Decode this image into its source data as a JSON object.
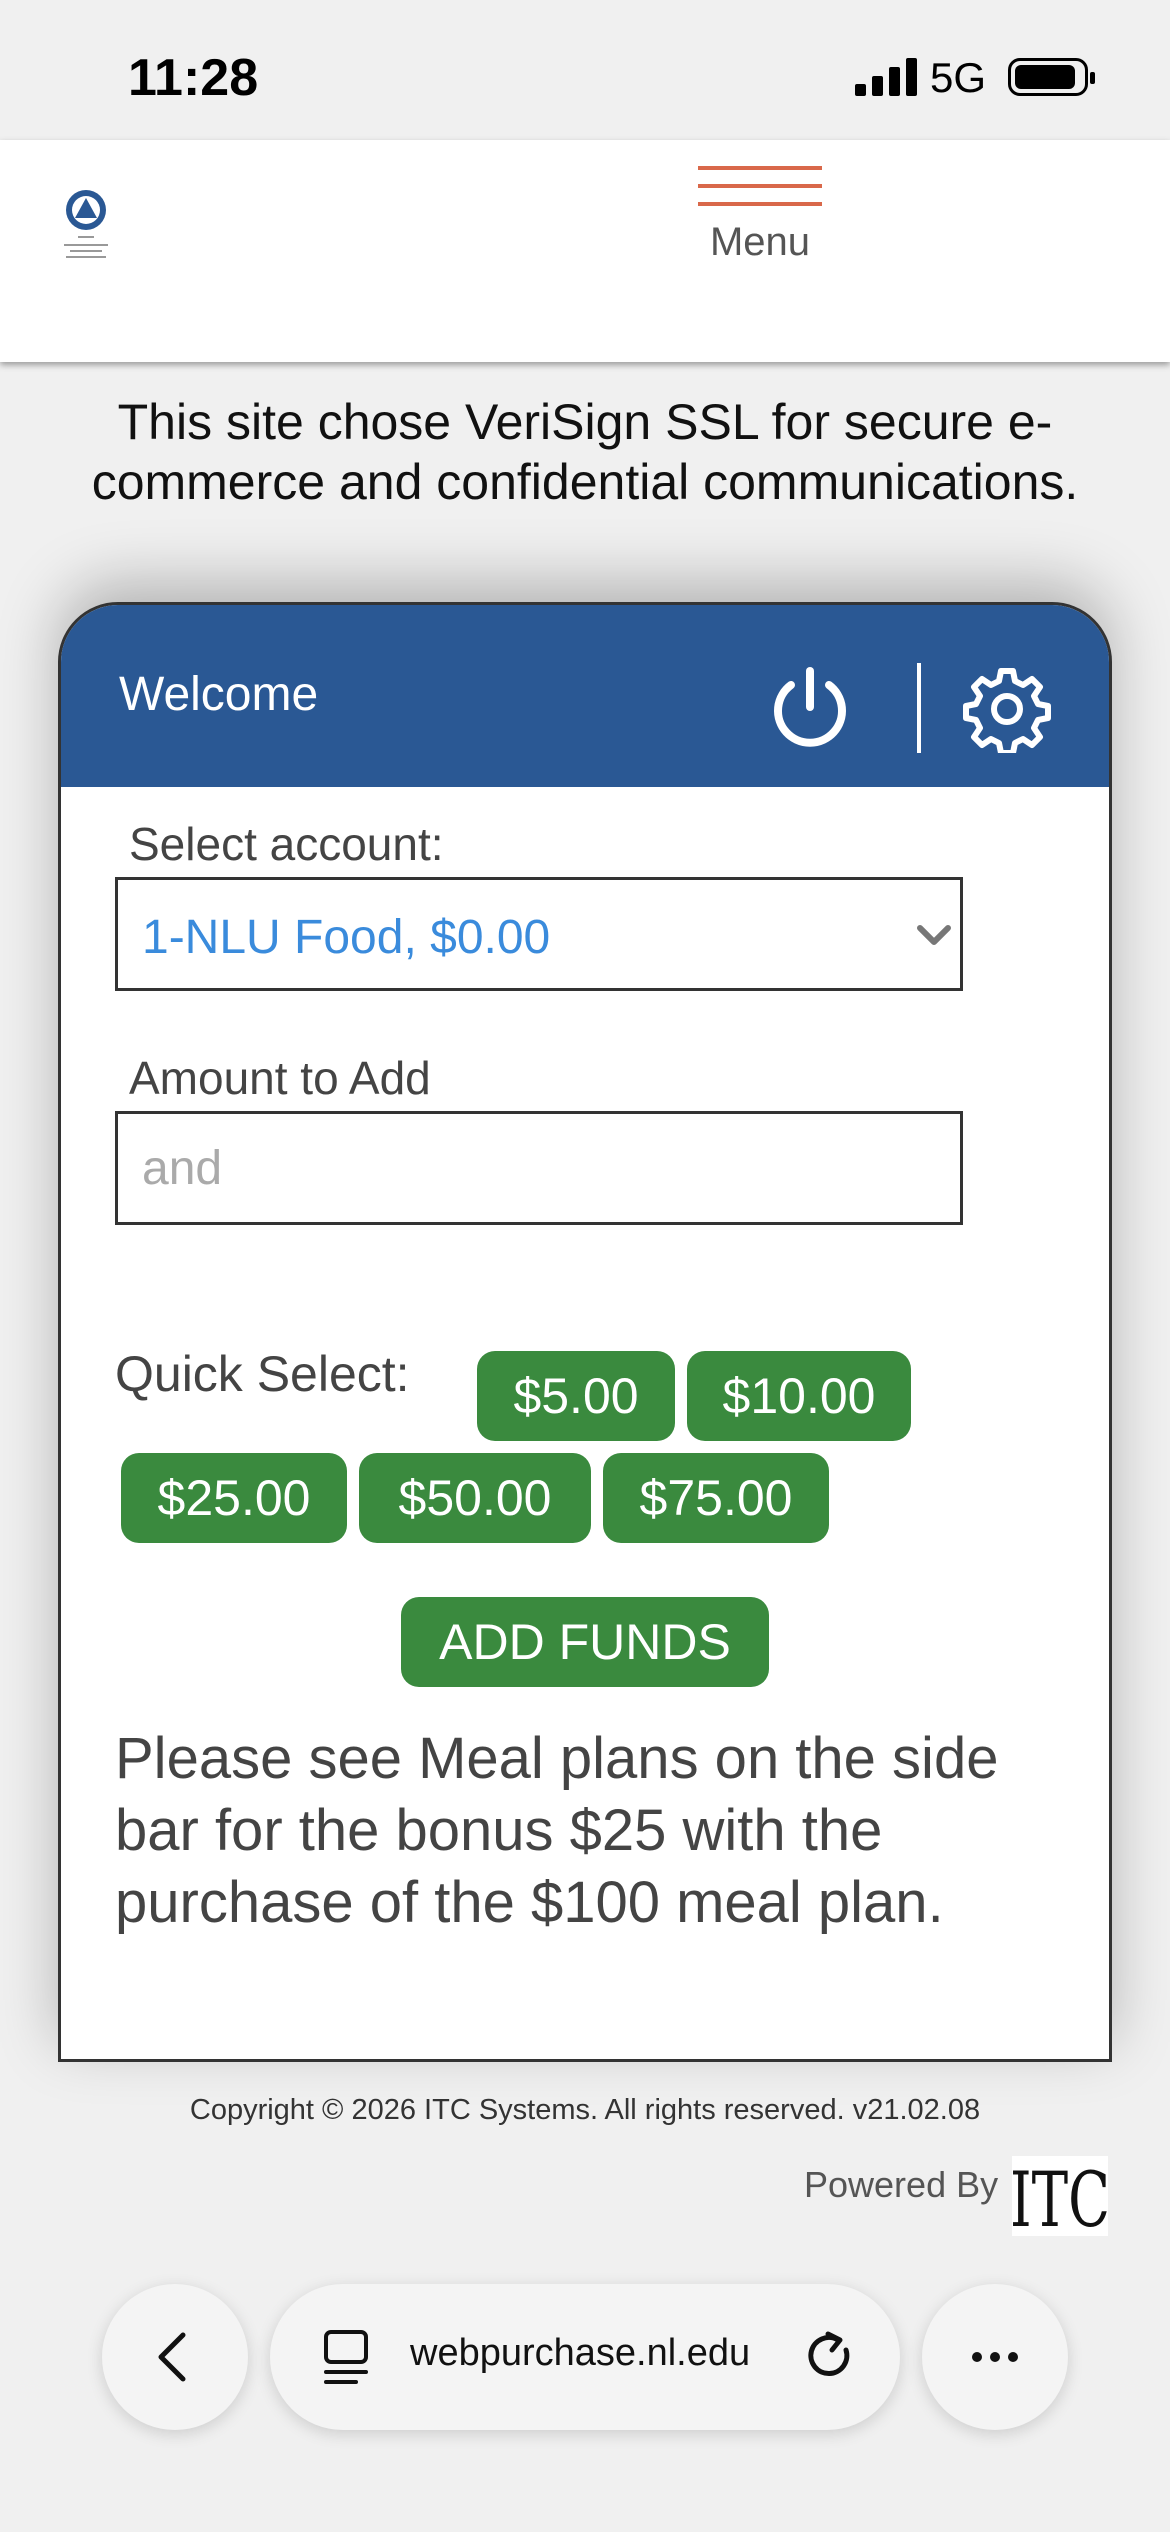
{
  "status_bar": {
    "time": "11:28",
    "network": "5G"
  },
  "header": {
    "logo_icon": "national-louis-university-logo",
    "menu_label": "Menu",
    "menu_color": "#d9684a"
  },
  "secure_notice": "This site chose VeriSign SSL for secure e-commerce and confidential communications.",
  "card": {
    "welcome": "Welcome",
    "header_color": "#2a5894",
    "select_label": "Select account:",
    "selected_account": "1-NLU Food, $0.00",
    "amount_label": "Amount to Add",
    "amount_placeholder": "and",
    "quick_select_label": "Quick Select:",
    "quick_amounts": [
      "$5.00",
      "$10.00",
      "$25.00",
      "$50.00",
      "$75.00"
    ],
    "add_funds": "ADD FUNDS",
    "note": "Please see Meal plans on the side bar for the bonus $25 with the purchase of the $100 meal plan.",
    "button_color": "#3a8a3e"
  },
  "footer": {
    "copyright": "Copyright © 2026 ITC Systems. All rights reserved. v21.02.08",
    "powered_by": "Powered By",
    "itc_logo_text": "ITC"
  },
  "browser": {
    "url": "webpurchase.nl.edu"
  }
}
